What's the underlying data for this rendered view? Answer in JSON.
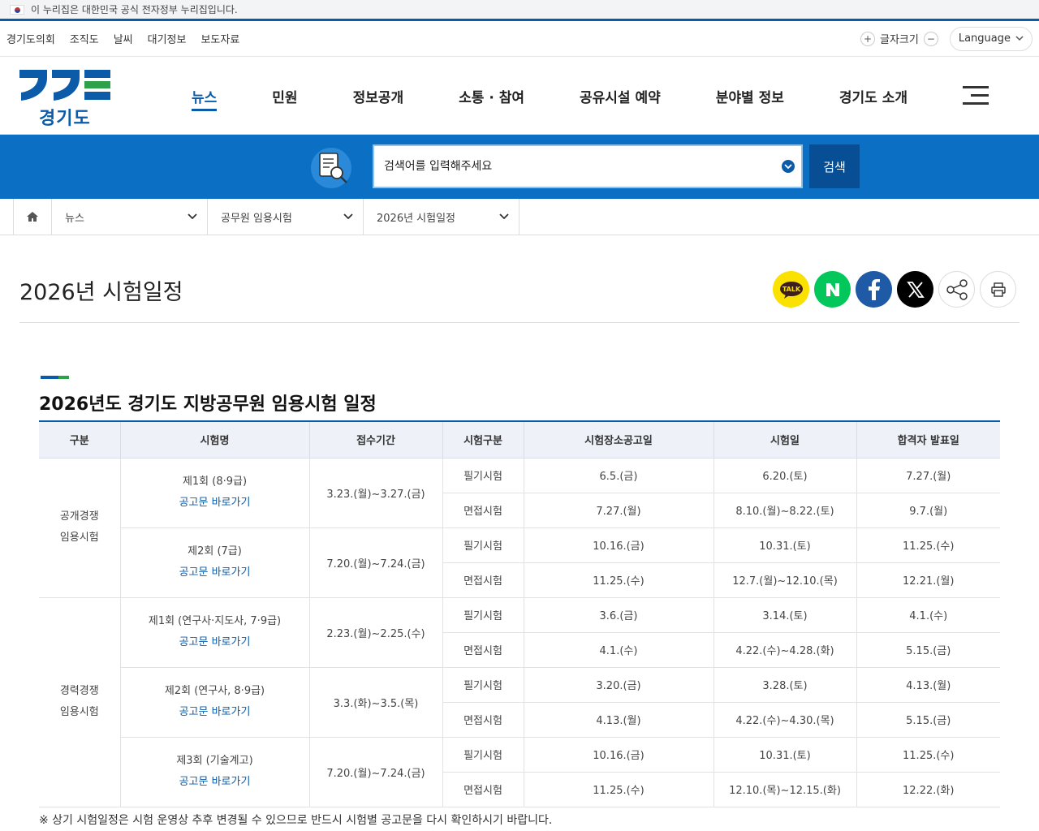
{
  "gov_banner": {
    "text": "이 누리집은 대한민국 공식 전자정부 누리집입니다."
  },
  "util": {
    "links": [
      "경기도의회",
      "조직도",
      "날씨",
      "대기정보",
      "보도자료"
    ],
    "font_size_label": "글자크기",
    "language_label": "Language"
  },
  "logo": {
    "text": "경기도"
  },
  "nav": {
    "items": [
      "뉴스",
      "민원",
      "정보공개",
      "소통 · 참여",
      "공유시설 예약",
      "분야별 정보",
      "경기도 소개"
    ],
    "active": 0
  },
  "search": {
    "placeholder": "검색어를 입력해주세요",
    "button_label": "검색"
  },
  "breadcrumb": {
    "items": [
      "뉴스",
      "공무원 임용시험",
      "2026년 시험일정"
    ]
  },
  "page": {
    "title": "2026년 시험일정",
    "share_icons": [
      "kakaotalk-icon",
      "naver-icon",
      "facebook-icon",
      "x-icon",
      "share-icon",
      "print-icon"
    ]
  },
  "section": {
    "title": "2026년도 경기도 지방공무원 임용시험 일정"
  },
  "table": {
    "headers": [
      "구분",
      "시험명",
      "접수기간",
      "시험구분",
      "시험장소공고일",
      "시험일",
      "합격자 발표일"
    ],
    "groups": [
      {
        "category_line1": "공개경쟁",
        "category_line2": "임용시험",
        "exams": [
          {
            "name": "제1회 (8·9급)",
            "link": "공고문 바로가기",
            "period": "3.23.(월)~3.27.(금)",
            "rows": [
              {
                "type": "필기시험",
                "venue": "6.5.(금)",
                "date": "6.20.(토)",
                "result": "7.27.(월)"
              },
              {
                "type": "면접시험",
                "venue": "7.27.(월)",
                "date": "8.10.(월)~8.22.(토)",
                "result": "9.7.(월)"
              }
            ]
          },
          {
            "name": "제2회 (7급)",
            "link": "공고문 바로가기",
            "period": "7.20.(월)~7.24.(금)",
            "rows": [
              {
                "type": "필기시험",
                "venue": "10.16.(금)",
                "date": "10.31.(토)",
                "result": "11.25.(수)"
              },
              {
                "type": "면접시험",
                "venue": "11.25.(수)",
                "date": "12.7.(월)~12.10.(목)",
                "result": "12.21.(월)"
              }
            ]
          }
        ]
      },
      {
        "category_line1": "경력경쟁",
        "category_line2": "임용시험",
        "exams": [
          {
            "name": "제1회 (연구사·지도사, 7·9급)",
            "link": "공고문 바로가기",
            "period": "2.23.(월)~2.25.(수)",
            "rows": [
              {
                "type": "필기시험",
                "venue": "3.6.(금)",
                "date": "3.14.(토)",
                "result": "4.1.(수)"
              },
              {
                "type": "면접시험",
                "venue": "4.1.(수)",
                "date": "4.22.(수)~4.28.(화)",
                "result": "5.15.(금)"
              }
            ]
          },
          {
            "name": "제2회 (연구사, 8·9급)",
            "link": "공고문 바로가기",
            "period": "3.3.(화)~3.5.(목)",
            "rows": [
              {
                "type": "필기시험",
                "venue": "3.20.(금)",
                "date": "3.28.(토)",
                "result": "4.13.(월)"
              },
              {
                "type": "면접시험",
                "venue": "4.13.(월)",
                "date": "4.22.(수)~4.30.(목)",
                "result": "5.15.(금)"
              }
            ]
          },
          {
            "name": "제3회 (기술계고)",
            "link": "공고문 바로가기",
            "period": "7.20.(월)~7.24.(금)",
            "rows": [
              {
                "type": "필기시험",
                "venue": "10.16.(금)",
                "date": "10.31.(토)",
                "result": "11.25.(수)"
              },
              {
                "type": "면접시험",
                "venue": "11.25.(수)",
                "date": "12.10.(목)~12.15.(화)",
                "result": "12.22.(화)"
              }
            ]
          }
        ]
      }
    ]
  },
  "footnote": "※ 상기 시험일정은 시험 운영상 추후 변경될 수 있으므로 반드시 시험별 공고문을 다시 확인하시기 바랍니다.",
  "colors": {
    "primary": "#0b5ba8",
    "search_band": "#0b6fc4",
    "accent_green": "#2ca14a",
    "kakao": "#fae100",
    "naver": "#03c75a",
    "facebook": "#1877f2"
  }
}
